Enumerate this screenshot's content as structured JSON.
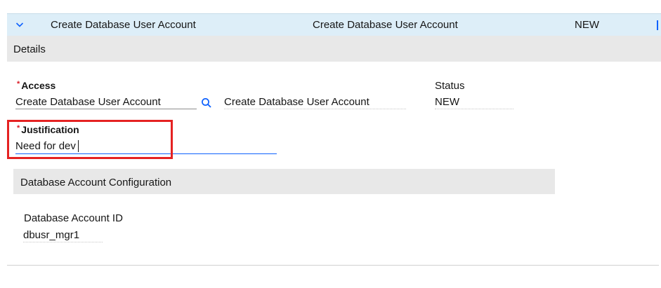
{
  "row": {
    "col1": "Create Database User Account",
    "col2": "Create Database User Account",
    "col3": "NEW"
  },
  "details": {
    "title": "Details"
  },
  "access": {
    "required_mark": "*",
    "label": "Access",
    "value": "Create Database User Account",
    "description": "Create Database User Account"
  },
  "status": {
    "label": "Status",
    "value": "NEW"
  },
  "justification": {
    "required_mark": "*",
    "label": "Justification",
    "value": "Need for dev"
  },
  "db_config": {
    "title": "Database Account Configuration",
    "account_id_label": "Database Account ID",
    "account_id_value": "dbusr_mgr1"
  },
  "colors": {
    "header_bg": "#ddeef8",
    "band_bg": "#e8e8e8",
    "accent": "#0f62fe",
    "required": "#da1e28",
    "highlight": "#e52222"
  }
}
